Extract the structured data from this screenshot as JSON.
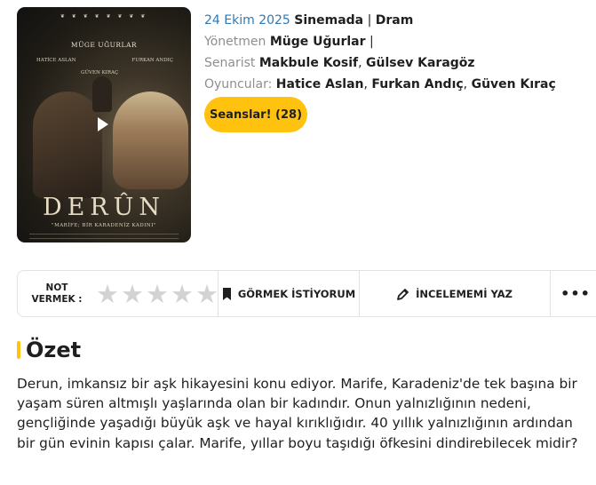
{
  "poster": {
    "director_credit": "MÜGE UĞURLAR",
    "cast_left": "HATİCE ASLAN",
    "cast_right": "FURKAN ANDIÇ",
    "cast_middle": "GÜVEN KIRAÇ",
    "title": "DERÛN",
    "tagline": "\"MARİFE; BİR KARADENİZ KADINI\""
  },
  "movie": {
    "release_date": "24 Ekim 2025",
    "status": "Sinemada",
    "separator": "|",
    "genre": "Dram",
    "director_label": "Yönetmen",
    "director": "Müge Uğurlar",
    "writer_label": "Senarist",
    "writers": [
      "Makbule Kosif",
      "Gülsev Karagöz"
    ],
    "cast_label": "Oyuncular:",
    "cast": [
      "Hatice Aslan",
      "Furkan Andıç",
      "Güven Kıraç"
    ]
  },
  "seans_button": "Seanslar! (28)",
  "actions": {
    "vote_label_line1": "NOT",
    "vote_label_line2": "VERMEK :",
    "star_rating": 0,
    "star_max": 5,
    "watchlist": "GÖRMEK İSTİYORUM",
    "review": "İNCELEMEMİ YAZ",
    "more": "•••"
  },
  "summary": {
    "heading": "Özet",
    "text": "Derun, imkansız bir aşk hikayesini konu ediyor. Marife, Karadeniz'de tek başına bir yaşam süren altmışlı yaşlarında olan bir kadındır. Onun yalnızlığının nedeni, gençliğinde yaşadığı büyük aşk ve hayal kırıklığıdır. 40 yıllık yalnızlığının ardından bir gün evinin kapısı çalar. Marife, yıllar boyu taşıdığı öfkesini dindirebilecek midir?"
  },
  "colors": {
    "accent": "#ffc20e",
    "date": "#2f79b4",
    "label": "#8e8e8e"
  }
}
